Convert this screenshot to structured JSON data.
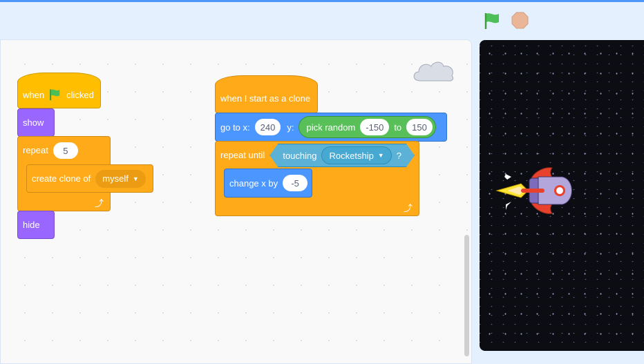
{
  "header": {
    "green_flag_icon": "green-flag",
    "stop_icon": "stop-sign"
  },
  "script1": {
    "hat": {
      "when": "when",
      "clicked": "clicked"
    },
    "show": "show",
    "repeat": {
      "label": "repeat",
      "count": "5"
    },
    "create_clone": {
      "label": "create clone of",
      "target": "myself"
    },
    "hide": "hide"
  },
  "script2": {
    "hat": "when I start as a clone",
    "goto": {
      "label": "go to x:",
      "x": "240",
      "y_label": "y:",
      "random_label": "pick random",
      "from": "-150",
      "to_label": "to",
      "to": "150"
    },
    "repeat_until": {
      "label": "repeat until",
      "touching": "touching",
      "target": "Rocketship",
      "q": "?"
    },
    "change_x": {
      "label": "change x by",
      "value": "-5"
    }
  },
  "colors": {
    "control": "#ffab19",
    "events": "#ffbf00",
    "looks": "#9966ff",
    "motion": "#4c97ff",
    "operators": "#59c059",
    "sensing": "#5cb1d6"
  }
}
